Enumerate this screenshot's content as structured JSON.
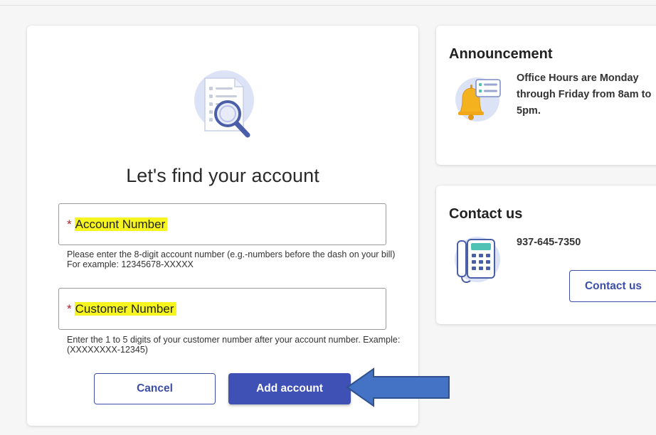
{
  "main": {
    "title": "Let's find your account",
    "account_field": {
      "required_mark": "*",
      "label": "Account Number",
      "help": "Please enter the 8-digit account number (e.g.-numbers before the dash on your bill) For example: 12345678-XXXXX"
    },
    "customer_field": {
      "required_mark": "*",
      "label": "Customer Number",
      "help": "Enter the 1 to 5 digits of your customer number after your account number. Example: (XXXXXXXX-12345)"
    },
    "cancel_label": "Cancel",
    "add_label": "Add account"
  },
  "announcement": {
    "heading": "Announcement",
    "text": "Office Hours are Monday through Friday from 8am to 5pm."
  },
  "contact": {
    "heading": "Contact us",
    "phone": "937-645-7350",
    "button_label": "Contact us"
  },
  "icons": {
    "hero": "document-search-icon",
    "announcement": "bell-notification-icon",
    "contact": "desk-phone-icon",
    "pointer": "pointing-arrow"
  },
  "colors": {
    "primary": "#3f51b5",
    "highlight": "#f7f51f",
    "required": "#b1232b",
    "arrow_fill": "#4472c4",
    "icon_circle": "#dde3f6"
  }
}
